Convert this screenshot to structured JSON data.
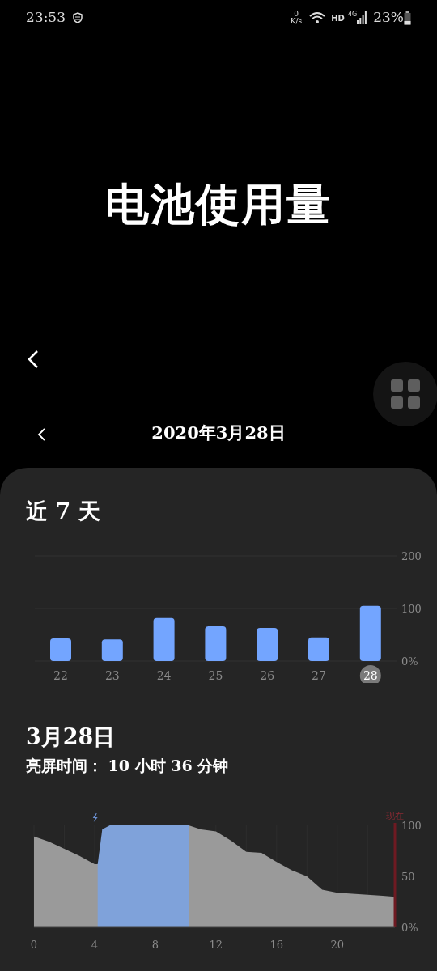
{
  "status_bar": {
    "time": "23:53",
    "net_speed_value": "0",
    "net_speed_unit": "K/s",
    "hd": "HD",
    "network": "4G",
    "battery": "23%"
  },
  "header": {
    "title": "电池使用量"
  },
  "date_nav": {
    "date": "2020年3月28日"
  },
  "week": {
    "title": "近 7 天",
    "days": [
      {
        "selected": false
      },
      {
        "selected": false
      },
      {
        "selected": false
      },
      {
        "selected": false
      },
      {
        "selected": false
      },
      {
        "selected": false
      },
      {
        "selected": true
      }
    ],
    "chart_data": {
      "type": "bar",
      "categories": [
        "22",
        "23",
        "24",
        "25",
        "26",
        "27",
        "28"
      ],
      "series": [
        {
          "color": "#73a5ff",
          "values": [
            43,
            41,
            82,
            66,
            63,
            45,
            105
          ]
        }
      ],
      "ylim": [
        0,
        200
      ],
      "yticks": [
        {
          "value": 0,
          "label": "0%"
        },
        {
          "value": 100,
          "label": "100"
        },
        {
          "value": 200,
          "label": "200"
        }
      ]
    }
  },
  "day": {
    "title": "3月28日",
    "screen_time": "亮屏时间： 10 小时 36 分钟",
    "chart_data": {
      "type": "area",
      "x": [
        0,
        1,
        2,
        3,
        4,
        4.2,
        4.5,
        5,
        6,
        7,
        8,
        9,
        10,
        10.2,
        11,
        12,
        13,
        14,
        15,
        16,
        17,
        18,
        19,
        20,
        21,
        22,
        23,
        23.8
      ],
      "series": [
        {
          "color": "#9a9a9a",
          "values": [
            89,
            84,
            77,
            70,
            62,
            62,
            null,
            null,
            null,
            null,
            null,
            null,
            null,
            100,
            96,
            94,
            85,
            74,
            73,
            64,
            56,
            50,
            37,
            34,
            33,
            32,
            31,
            30
          ]
        },
        {
          "color": "#7fa2da",
          "values": [
            null,
            null,
            null,
            null,
            null,
            62,
            96,
            100,
            100,
            100,
            100,
            100,
            100,
            100,
            null,
            null,
            null,
            null,
            null,
            null,
            null,
            null,
            null,
            null,
            null,
            null,
            null,
            null
          ]
        }
      ],
      "xlim": [
        0,
        23.8
      ],
      "ylim": [
        0,
        100
      ],
      "xticks": [
        0,
        4,
        8,
        12,
        16,
        20
      ],
      "yticks": [
        {
          "value": 0,
          "label": "0%"
        },
        {
          "value": 50,
          "label": "50"
        },
        {
          "value": 100,
          "label": "100"
        }
      ],
      "annotations": [
        "现在"
      ]
    }
  }
}
